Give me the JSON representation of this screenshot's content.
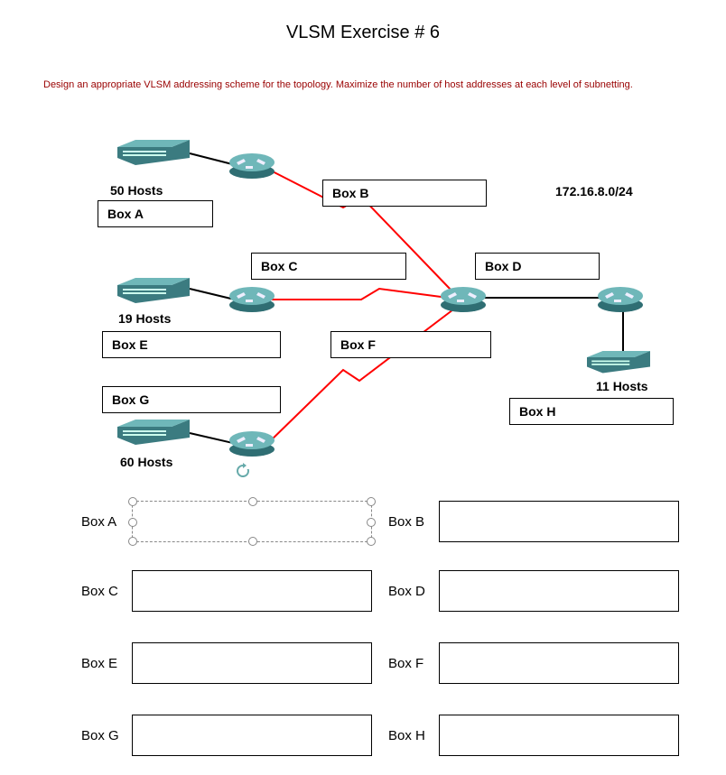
{
  "title": "VLSM Exercise # 6",
  "instructions": "Design an appropriate VLSM addressing scheme for the topology.  Maximize the number of host addresses at each level of subnetting.",
  "network": "172.16.8.0/24",
  "topology": {
    "segA": {
      "hosts": "50  Hosts",
      "label": "Box A"
    },
    "segE": {
      "hosts": "19  Hosts",
      "label": "Box E"
    },
    "segG": {
      "hosts": "60 Hosts",
      "label": "Box G"
    },
    "segH": {
      "hosts": "11 Hosts",
      "label": "Box H"
    },
    "linkB": "Box B",
    "linkC": "Box C",
    "linkD": "Box D",
    "linkF": "Box F"
  },
  "answers": {
    "A": {
      "label": "Box A",
      "value": ""
    },
    "B": {
      "label": "Box B",
      "value": ""
    },
    "C": {
      "label": "Box C",
      "value": ""
    },
    "D": {
      "label": "Box D",
      "value": ""
    },
    "E": {
      "label": "Box E",
      "value": ""
    },
    "F": {
      "label": "Box F",
      "value": ""
    },
    "G": {
      "label": "Box G",
      "value": ""
    },
    "H": {
      "label": "Box H",
      "value": ""
    }
  }
}
